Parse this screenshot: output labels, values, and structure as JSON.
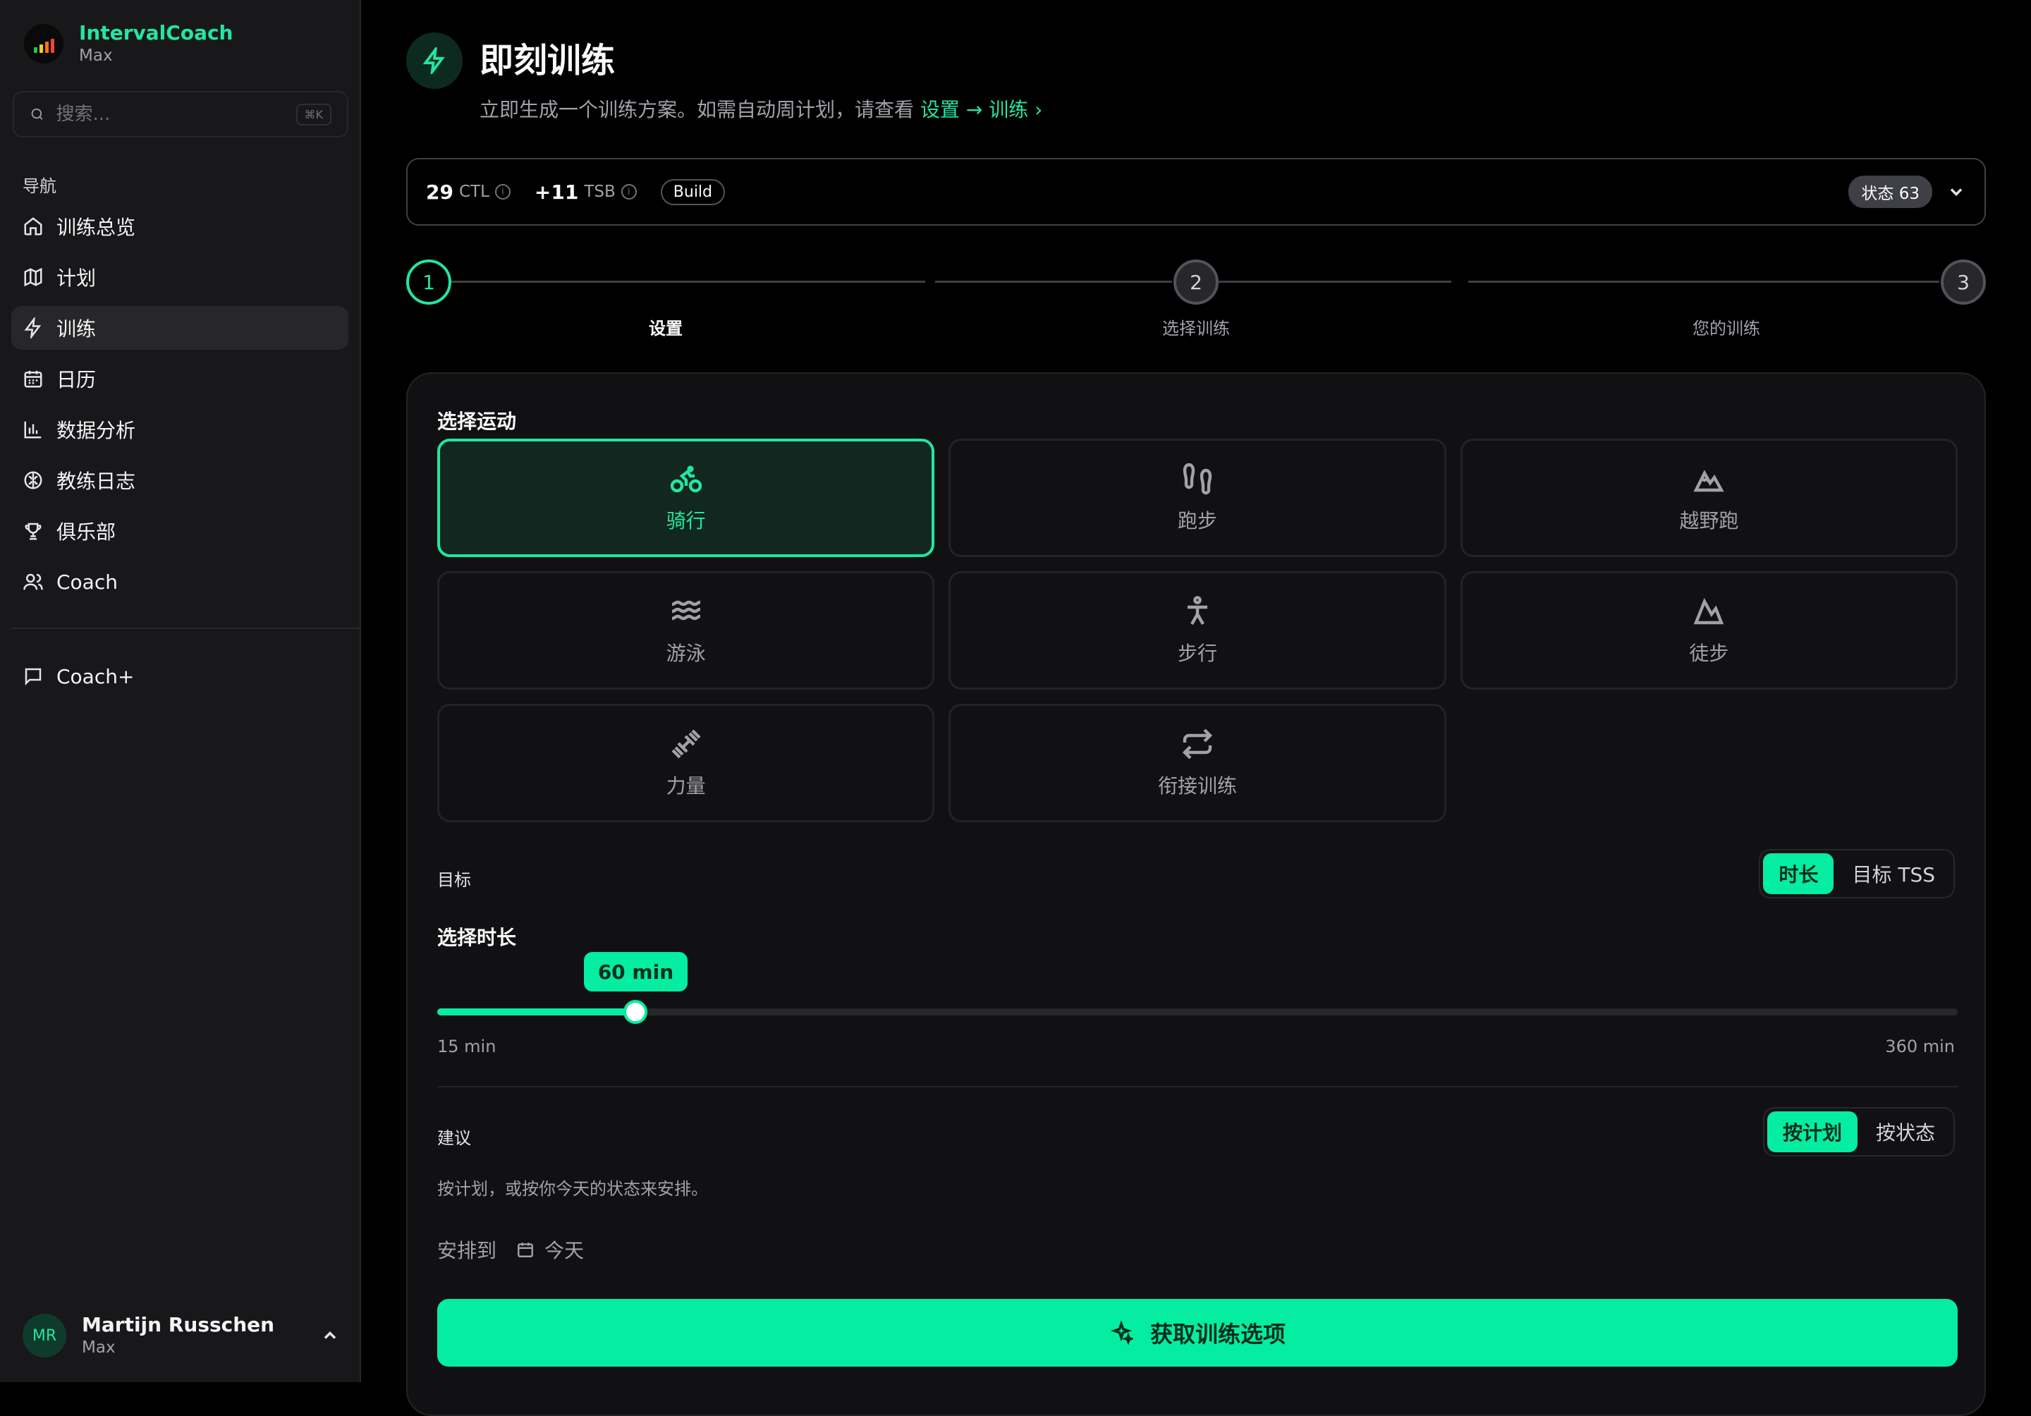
{
  "brand": {
    "name": "IntervalCoach",
    "plan": "Max",
    "logo_colors": [
      "#22c55e",
      "#facc15",
      "#f97316",
      "#ef4444"
    ]
  },
  "search": {
    "placeholder": "搜索...",
    "shortcut": "⌘K"
  },
  "nav": {
    "heading": "导航",
    "items": [
      {
        "label": "训练总览",
        "icon": "home-icon"
      },
      {
        "label": "计划",
        "icon": "map-icon"
      },
      {
        "label": "训练",
        "icon": "bolt-icon",
        "active": true
      },
      {
        "label": "日历",
        "icon": "calendar-icon"
      },
      {
        "label": "数据分析",
        "icon": "bar-chart-icon"
      },
      {
        "label": "教练日志",
        "icon": "brain-icon"
      },
      {
        "label": "俱乐部",
        "icon": "trophy-icon"
      },
      {
        "label": "Coach",
        "icon": "users-icon"
      }
    ],
    "extra": [
      {
        "label": "Coach+",
        "icon": "message-square-icon"
      }
    ]
  },
  "user": {
    "initials": "MR",
    "name": "Martijn Russchen",
    "plan": "Max"
  },
  "header": {
    "title": "即刻训练",
    "subtitle": "立即生成一个训练方案。如需自动周计划，请查看",
    "link": "设置 → 训练 ›"
  },
  "status": {
    "ctl_value": "29",
    "ctl_label": "CTL",
    "tsb_value": "+11",
    "tsb_label": "TSB",
    "phase": "Build",
    "state": "状态 63"
  },
  "stepper": {
    "steps": [
      {
        "num": "1",
        "label": "设置",
        "state": "done"
      },
      {
        "num": "2",
        "label": "选择训练",
        "state": "todo"
      },
      {
        "num": "3",
        "label": "您的训练",
        "state": "todo"
      }
    ]
  },
  "sport_section": {
    "label": "选择运动",
    "sports": [
      {
        "label": "骑行",
        "icon": "bike-icon",
        "selected": true
      },
      {
        "label": "跑步",
        "icon": "footprints-icon"
      },
      {
        "label": "越野跑",
        "icon": "mountain-snow-icon"
      },
      {
        "label": "游泳",
        "icon": "waves-icon"
      },
      {
        "label": "步行",
        "icon": "person-walking-icon"
      },
      {
        "label": "徒步",
        "icon": "mountain-icon"
      },
      {
        "label": "力量",
        "icon": "dumbbell-icon"
      },
      {
        "label": "衔接训练",
        "icon": "repeat-icon"
      }
    ]
  },
  "goal": {
    "label": "目标",
    "options": [
      {
        "label": "时长",
        "on": true
      },
      {
        "label": "目标 TSS",
        "on": false
      }
    ]
  },
  "duration": {
    "label": "选择时长",
    "value_label": "60 min",
    "value": 60,
    "min": 15,
    "max": 360,
    "min_label": "15 min",
    "max_label": "360 min"
  },
  "suggest": {
    "label": "建议",
    "options": [
      {
        "label": "按计划",
        "on": true
      },
      {
        "label": "按状态",
        "on": false
      }
    ],
    "hint": "按计划，或按你今天的状态来安排。"
  },
  "schedule": {
    "label": "安排到",
    "date": "今天"
  },
  "cta": {
    "label": "获取训练选项"
  },
  "colors": {
    "accent": "#05eda0",
    "brand_green": "#22e6a0",
    "sidebar_bg": "#18181b",
    "card_bg": "#111113"
  }
}
